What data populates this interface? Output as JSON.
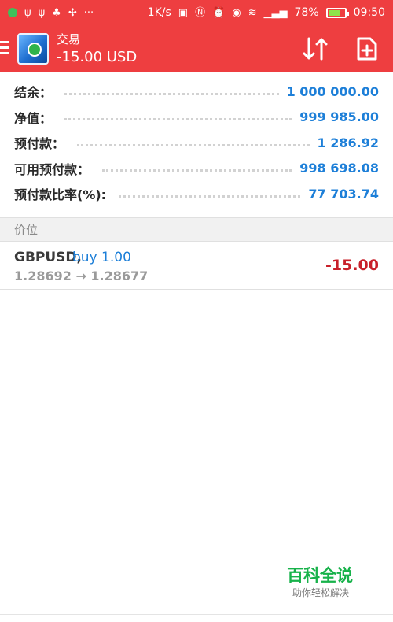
{
  "status_bar": {
    "left_icons": [
      "app-notification-icon",
      "usb-icon",
      "usb-icon",
      "game-icon",
      "pinwheel-icon"
    ],
    "more": "···",
    "net_speed": "1K/s",
    "battery_percent": "78%",
    "battery_level": 0.78,
    "time": "09:50"
  },
  "app_bar": {
    "title": "交易",
    "balance": "-15.00 USD",
    "accent_color": "#ee3e40"
  },
  "account": {
    "rows": [
      {
        "label": "结余：",
        "value": "1 000 000.00"
      },
      {
        "label": "净值：",
        "value": "999 985.00"
      },
      {
        "label": "预付款：",
        "value": "1 286.92"
      },
      {
        "label": "可用预付款：",
        "value": "998 698.08"
      },
      {
        "label": "预付款比率(%):",
        "value": "77 703.74"
      }
    ]
  },
  "positions_section": {
    "header": "价位"
  },
  "position": {
    "symbol": "GBPUSD,",
    "side": "buy 1.00",
    "prices": "1.28692 → 1.28677",
    "profit": "-15.00"
  },
  "watermark": {
    "title": "百科全说",
    "subtitle": "助你轻松解决"
  }
}
